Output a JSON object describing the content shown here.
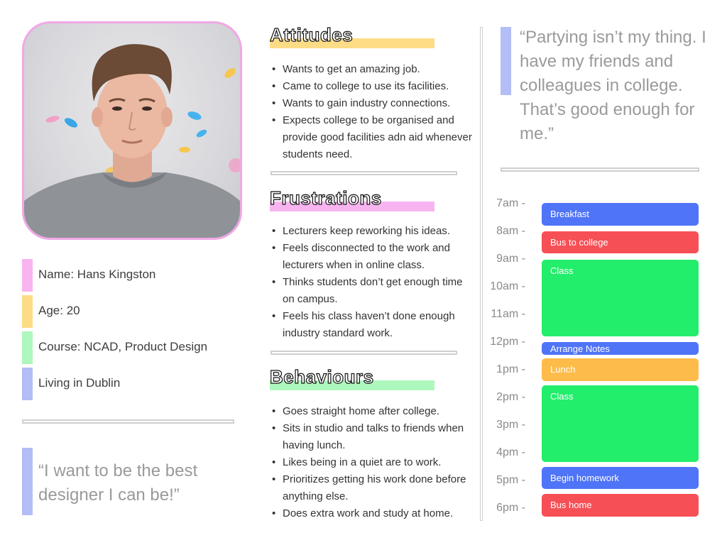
{
  "persona": {
    "name_line": "Name: Hans Kingston",
    "age_line": "Age: 20",
    "course_line": "Course: NCAD, Product Design",
    "location_line": "Living in Dublin",
    "quote": "“I want to be the best designer I can be!”",
    "colors": {
      "pink": "#f8b4f0",
      "yellow": "#fddc86",
      "green": "#aef7bd",
      "blue": "#b3bdf6"
    }
  },
  "sections": {
    "attitudes": {
      "title": "Attitudes",
      "items": [
        "Wants to get an amazing job.",
        "Came to college to use its facilities.",
        "Wants to gain industry connections.",
        "Expects college to be organised and provide good facilities adn aid whenever students need."
      ]
    },
    "frustrations": {
      "title": "Frustrations",
      "items": [
        "Lecturers keep reworking his ideas.",
        "Feels disconnected to the work and lecturers when in online class.",
        "Thinks students don’t get enough time on campus.",
        "Feels his class haven’t done enough industry standard work."
      ]
    },
    "behaviours": {
      "title": "Behaviours",
      "items": [
        "Goes straight home after college.",
        "Sits in studio and talks to friends when having lunch.",
        "Likes being in a quiet are to work.",
        "Prioritizes getting his work done before anything else.",
        "Does extra work and study at home."
      ]
    }
  },
  "side_quote": "“Partying isn’t my thing. I have my friends and colleagues in college. That’s good enough for me.”",
  "schedule": {
    "times": [
      "7am -",
      "8am -",
      "9am -",
      "10am -",
      "11am -",
      "12pm -",
      "1pm -",
      "2pm -",
      "3pm -",
      "4pm -",
      "5pm -",
      "6pm -"
    ],
    "events": [
      {
        "label": "Breakfast",
        "color": "#4f74f7"
      },
      {
        "label": "Bus to college",
        "color": "#f74f56"
      },
      {
        "label": "Class",
        "color": "#23ee6b"
      },
      {
        "label": "Arrange Notes",
        "color": "#4f74f7"
      },
      {
        "label": "Lunch",
        "color": "#fdbc4a"
      },
      {
        "label": "Class",
        "color": "#23ee6b"
      },
      {
        "label": "Begin homework",
        "color": "#4f74f7"
      },
      {
        "label": "Bus home",
        "color": "#f74f56"
      }
    ]
  }
}
